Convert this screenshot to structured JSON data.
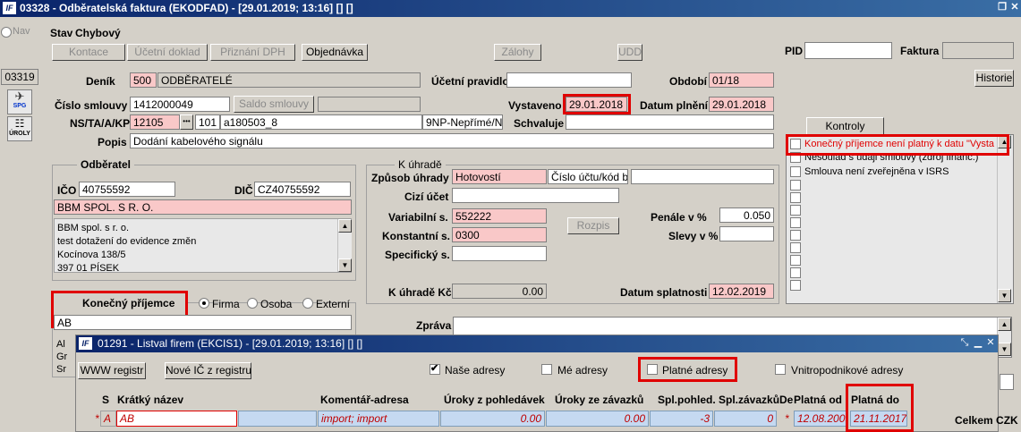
{
  "main_window": {
    "title": "03328 - Odběratelská faktura (EKODFAD) - [29.01.2019; 13:16] [] []",
    "logo": "IF"
  },
  "left_panel": {
    "nav_label": "Nav",
    "counter": "03319",
    "spg_label": "SPG",
    "uroly_label": "ÚROLY"
  },
  "stav": {
    "label": "Stav",
    "value": "Chybový"
  },
  "toolbar": {
    "kontace": "Kontace",
    "ucetni_doklad": "Účetní doklad",
    "priznani_dph": "Přiznání DPH",
    "objednavka": "Objednávka",
    "zalohy": "Zálohy",
    "udd": "UDD"
  },
  "header": {
    "pid_label": "PID",
    "pid_value": "",
    "faktura_label": "Faktura",
    "faktura_value": "",
    "historie": "Historie"
  },
  "form": {
    "denik_label": "Deník",
    "denik_code": "500",
    "denik_name": "ODBĚRATELÉ",
    "ucetni_pravidlo_label": "Účetní pravidlo",
    "ucetni_pravidlo_value": "",
    "obdobi_label": "Období",
    "obdobi_value": "01/18",
    "cislo_smlouvy_label": "Číslo smlouvy",
    "cislo_smlouvy_value": "1412000049",
    "saldo_smlouvy": "Saldo smlouvy",
    "vystaveno_label": "Vystaveno",
    "vystaveno_value": "29.01.2018",
    "datum_plneni_label": "Datum plnění",
    "datum_plneni_value": "29.01.2018",
    "ns_label": "NS/TA/A/KP",
    "ns_value": "12105",
    "ellipsis": "•••",
    "ta_value": "101",
    "a_value": "a180503_8",
    "kp_value": "9NP-Nepřímé/Nerc",
    "schvaluje_label": "Schvaluje",
    "schvaluje_value": "",
    "popis_label": "Popis",
    "popis_value": "Dodání kabelového signálu"
  },
  "odberatel": {
    "legend": "Odběratel",
    "ico_label": "IČO",
    "ico_value": "40755592",
    "dic_label": "DIČ",
    "dic_value": "CZ40755592",
    "name": "BBM SPOL. S R. O.",
    "address_lines": [
      "BBM spol. s r. o.",
      "test dotažení do evidence změn",
      "Kocínova 138/5",
      "397 01 PÍSEK"
    ]
  },
  "konecny": {
    "label": "Konečný příjemce",
    "firma": "Firma",
    "osoba": "Osoba",
    "externi": "Externí",
    "value": "AB",
    "peek_lines": [
      "Al",
      "Gr",
      "Sr"
    ]
  },
  "k_uhrade": {
    "legend": "K úhradě",
    "zpusob_label": "Způsob úhrady",
    "zpusob_value": "Hotovostí",
    "cislo_uctu_value": "Číslo účtu/kód bar",
    "cizi_ucet_label": "Cizí účet",
    "variabilni_label": "Variabilní s.",
    "variabilni_value": "552222",
    "konstantni_label": "Konstantní s.",
    "konstantni_value": "0300",
    "specificky_label": "Specifický s.",
    "rozpis": "Rozpis",
    "penale_label": "Penále v %",
    "penale_value": "0.050",
    "slevy_label": "Slevy v %",
    "k_uhrade_kc_label": "K úhradě Kč",
    "k_uhrade_kc_value": "0.00",
    "datum_splatnosti_label": "Datum splatnosti",
    "datum_splatnosti_value": "12.02.2019"
  },
  "zprava": {
    "label": "Zpráva"
  },
  "kontroly": {
    "tab": "Kontroly",
    "items": [
      "Konečný příjemce není platný k datu \"Vysta",
      "Nesoulad s údaji smlouvy (zdroj financ.)",
      "Smlouva není zveřejněna v ISRS"
    ]
  },
  "popup": {
    "title": "01291 - Listval firem (EKCIS1) - [29.01.2019; 13:16] [] []",
    "www_registr": "WWW registr",
    "nove_ic": "Nové IČ z registru",
    "nase_adresy": "Naše adresy",
    "me_adresy": "Mé adresy",
    "platne_adresy": "Platné adresy",
    "vnitropodnikove": "Vnitropodnikové adresy",
    "columns": [
      "S",
      "Krátký název",
      "Komentář-adresa",
      "Úroky z pohledávek",
      "Úroky ze závazků",
      "Spl.pohled.",
      "Spl.závazků",
      "De",
      "Platná od",
      "Platná do"
    ],
    "row": {
      "marker": "*",
      "s": "A",
      "kratky_nazev": "AB",
      "komentar": "import; import",
      "uroky_pohl": "0.00",
      "uroky_zav": "0.00",
      "spl_pohled": "-3",
      "spl_zavazku": "0",
      "de": "*",
      "platna_od": "12.08.2009",
      "platna_do": "21.11.2017"
    }
  },
  "celkem": {
    "label": "Celkem CZK"
  }
}
